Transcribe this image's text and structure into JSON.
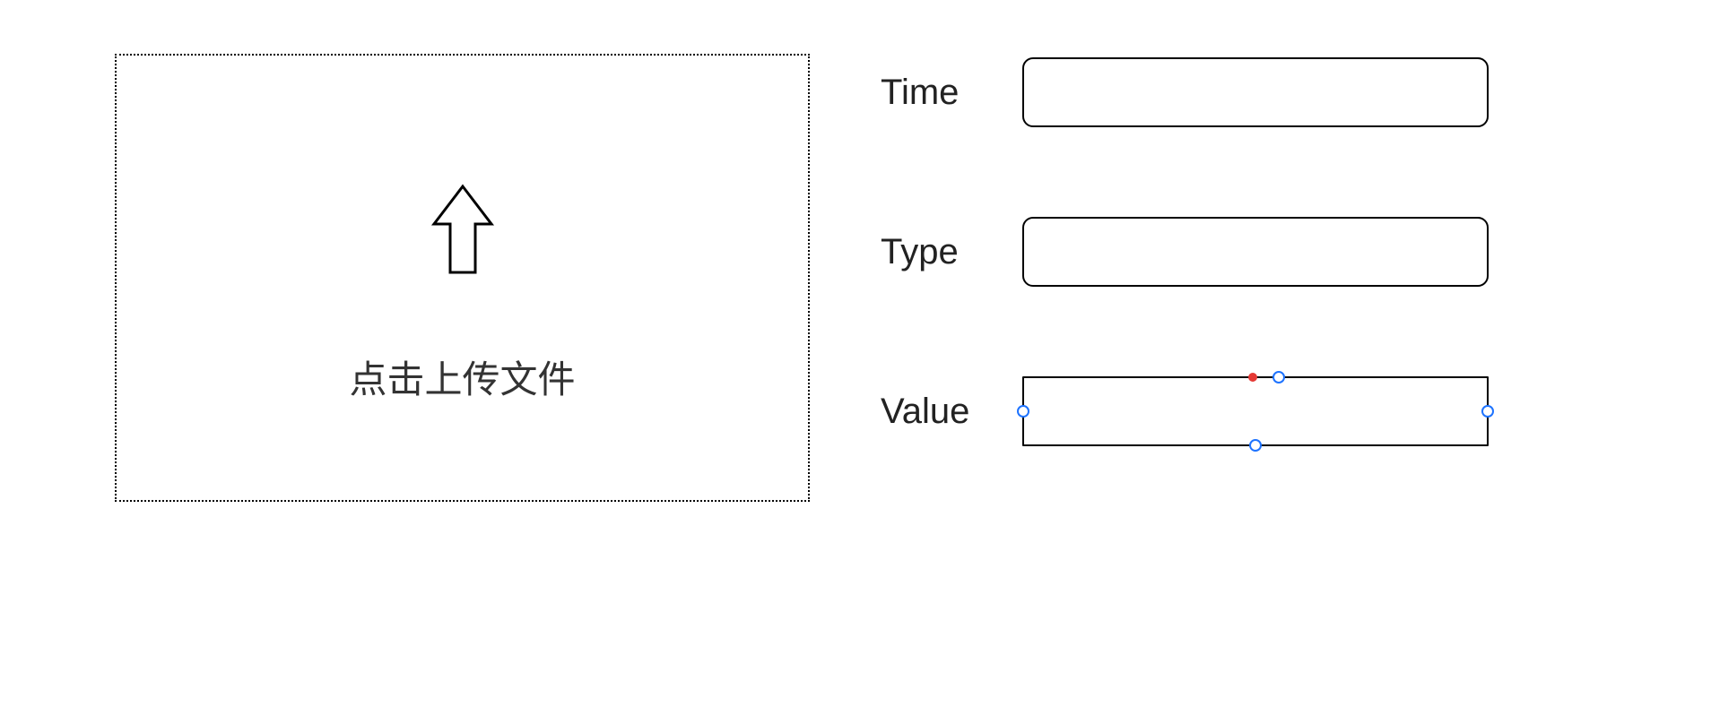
{
  "upload": {
    "label": "点击上传文件",
    "icon_name": "upload-arrow-icon"
  },
  "fields": {
    "time": {
      "label": "Time",
      "value": ""
    },
    "type": {
      "label": "Type",
      "value": ""
    },
    "value": {
      "label": "Value",
      "value": ""
    }
  }
}
